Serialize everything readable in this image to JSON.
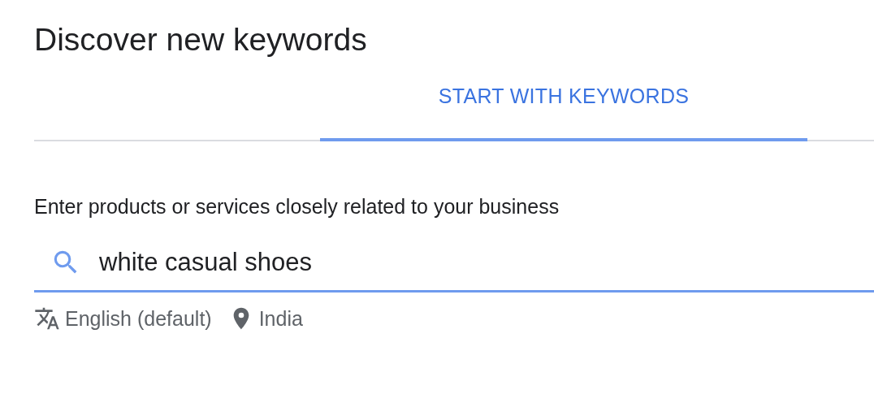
{
  "heading": "Discover new keywords",
  "tabs": [
    {
      "label": "START WITH KEYWORDS",
      "selected": true
    }
  ],
  "field": {
    "label": "Enter products or services closely related to your business",
    "value": "white casual shoes"
  },
  "settings": [
    {
      "kind": "language",
      "label": "English (default)"
    },
    {
      "kind": "location",
      "label": "India"
    }
  ]
}
